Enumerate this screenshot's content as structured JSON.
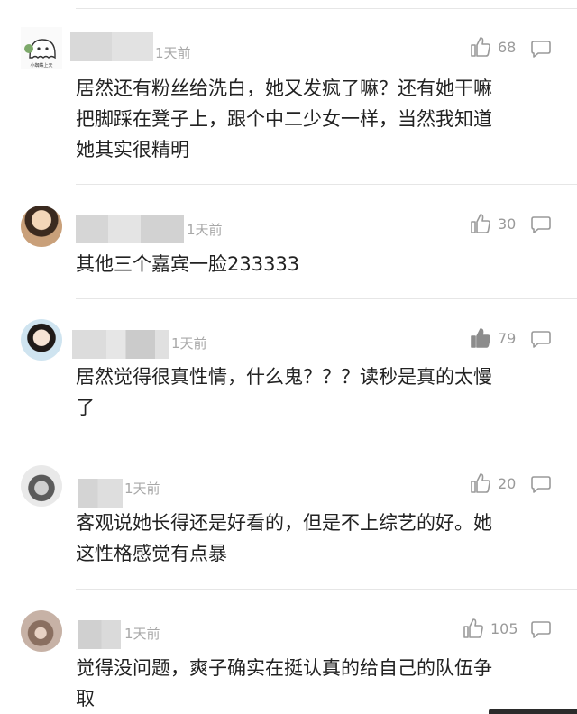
{
  "comments": [
    {
      "avatar_label": "小蜘蛛上天",
      "time": "1天前",
      "likes": "68",
      "liked": false,
      "text_lines": [
        "居然还有粉丝给洗白，她又发疯了嘛？还有她干嘛",
        "把脚踩在凳子上，跟个中二少女一样，当然我知道",
        "她其实很精明"
      ]
    },
    {
      "time": "1天前",
      "likes": "30",
      "liked": false,
      "text_lines": [
        "其他三个嘉宾一脸233333"
      ]
    },
    {
      "time": "1天前",
      "likes": "79",
      "liked": true,
      "text_lines": [
        "居然觉得很真性情，什么鬼？？？读秒是真的太慢",
        "了"
      ]
    },
    {
      "time": "1天前",
      "likes": "20",
      "liked": false,
      "text_lines": [
        "客观说她长得还是好看的，但是不上综艺的好。她",
        "这性格感觉有点暴"
      ]
    },
    {
      "time": "1天前",
      "likes": "105",
      "liked": false,
      "text_lines": [
        "觉得没问题，爽子确实在挺认真的给自己的队伍争",
        "取"
      ]
    }
  ],
  "colors": {
    "text": "#222222",
    "meta": "#a8a8a8",
    "icon": "#9a9a9a",
    "liked_icon": "#8c8c8c",
    "blur": "#d0d0d0",
    "divider": "#e6e6e6"
  },
  "icons": {
    "like": "thumbs-up-icon",
    "reply": "comment-bubble-icon"
  }
}
